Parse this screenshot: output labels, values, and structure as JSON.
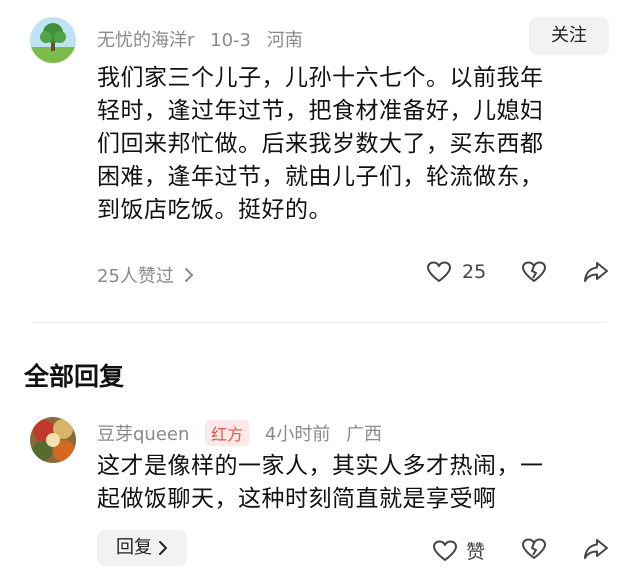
{
  "comment": {
    "author": "无忧的海洋r",
    "date": "10-3",
    "location": "河南",
    "follow_label": "关注",
    "text_lines": [
      "我们家三个儿子，儿孙十六七个。以前我年",
      "轻时，逢过年过节，把食材准备好，儿媳妇",
      "们回来邦忙做。后来我岁数大了，买东西都",
      "困难，逢年过节，就由儿子们，轮流做东，",
      "到饭店吃饭。挺好的。"
    ],
    "liked_by": "25人赞过",
    "like_count": "25"
  },
  "section_title": "全部回复",
  "reply": {
    "author": "豆芽queen",
    "badge": "红方",
    "time": "4小时前",
    "location": "广西",
    "text_lines": [
      "这才是像样的一家人，其实人多才热闹，一",
      "起做饭聊天，这种时刻简直就是享受啊"
    ],
    "reply_label": "回复",
    "like_label": "赞"
  },
  "icons": {
    "chevron": "chevron-right-icon",
    "like": "heart-icon",
    "dislike": "broken-heart-icon",
    "share": "share-icon"
  },
  "colors": {
    "badge_text": "#e2574c",
    "badge_bg": "#fde9e7",
    "meta": "#8a8a8a"
  }
}
